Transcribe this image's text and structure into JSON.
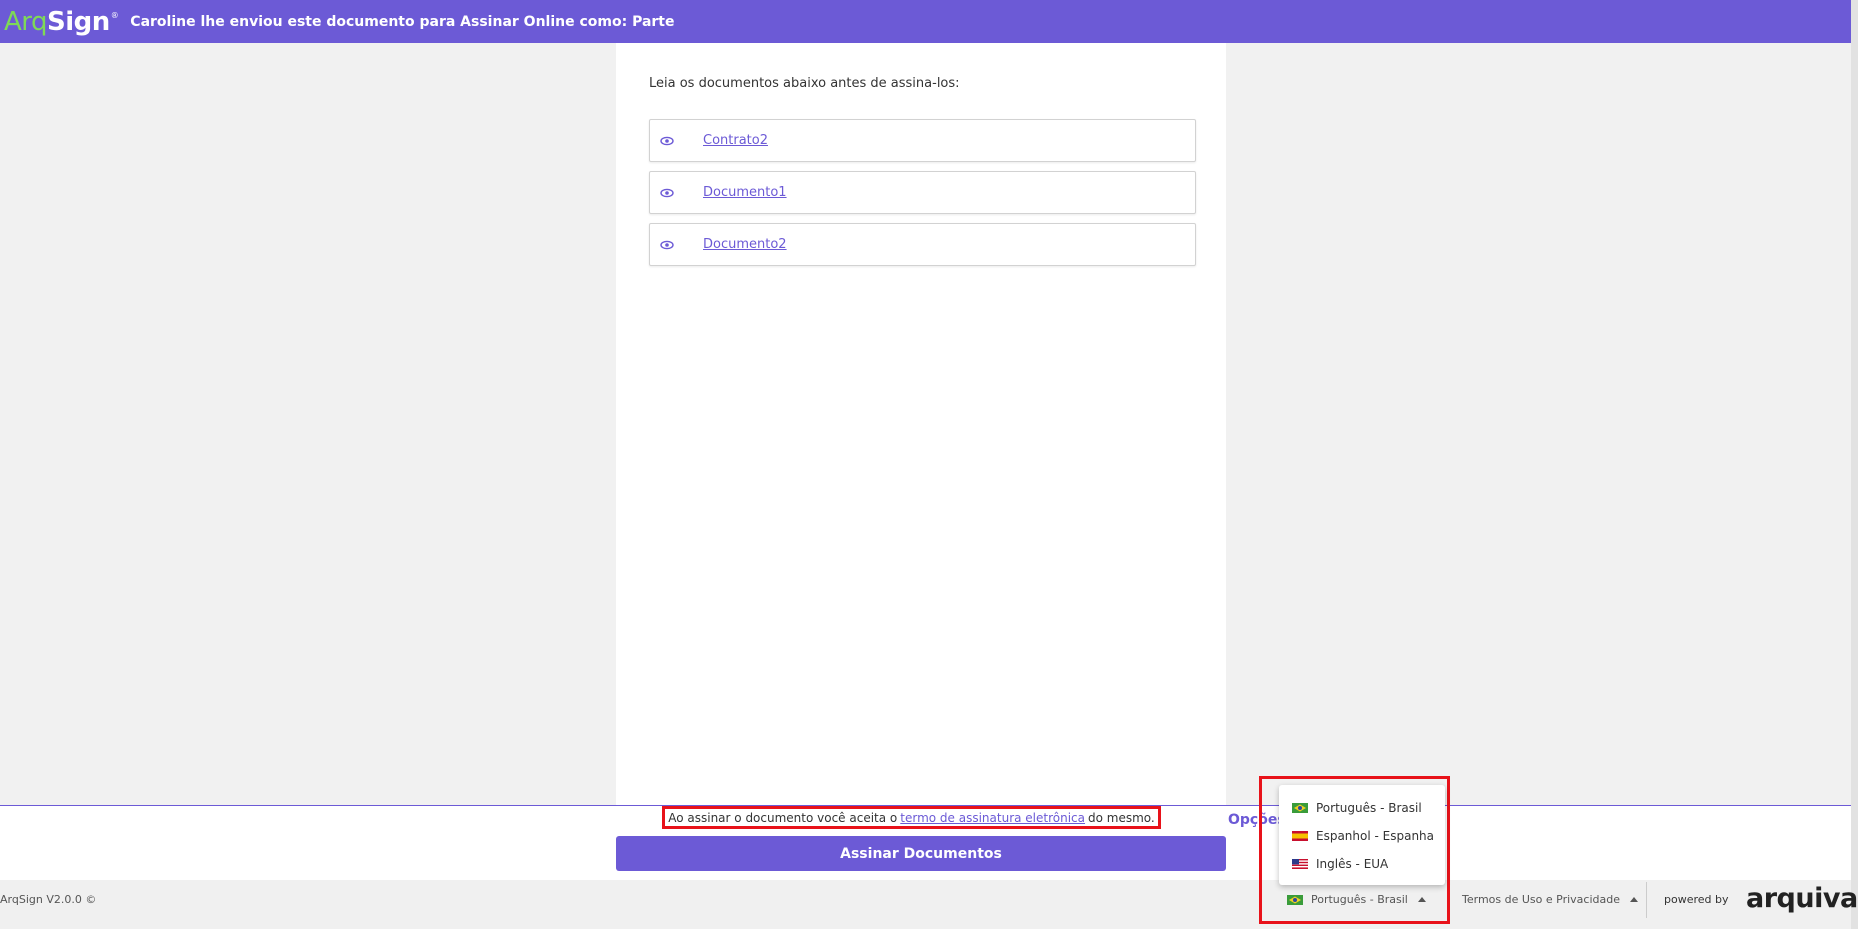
{
  "header": {
    "logo_arq": "Arq",
    "logo_sign": "Sign",
    "logo_reg": "®",
    "title": "Caroline lhe enviou este documento para Assinar Online como: Parte"
  },
  "main": {
    "intro": "Leia os documentos abaixo antes de assina-los:",
    "documents": [
      {
        "label": "Contrato2",
        "icon": "eye-icon"
      },
      {
        "label": "Documento1",
        "icon": "eye-icon"
      },
      {
        "label": "Documento2",
        "icon": "eye-icon"
      }
    ]
  },
  "footer": {
    "terms_prefix": "Ao assinar o documento você aceita o",
    "terms_link": "termo de assinatura eletrônica",
    "terms_suffix": "do mesmo.",
    "options_label": "Opções",
    "sign_button": "Assinar Documentos",
    "version": "ArqSign V2.0.0 ©",
    "language_selected": "Português - Brasil",
    "terms_privacy": "Termos de Uso e Privacidade",
    "powered_by": "powered by",
    "brand": "arquivar",
    "brand_dot": "."
  },
  "language_menu": {
    "options": [
      {
        "label": "Português - Brasil",
        "flag": "brazil-flag-icon"
      },
      {
        "label": "Espanhol - Espanha",
        "flag": "spain-flag-icon"
      },
      {
        "label": "Inglês - EUA",
        "flag": "usa-flag-icon"
      }
    ]
  },
  "colors": {
    "accent": "#6c5ad6",
    "logo_green": "#7ed957",
    "highlight_red": "#e8121a"
  }
}
